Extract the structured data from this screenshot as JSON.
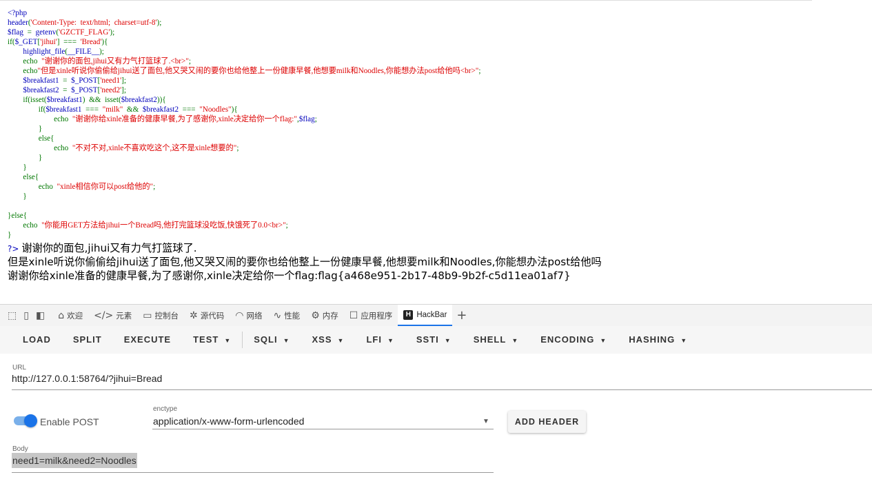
{
  "code_lines": [
    [
      [
        "v",
        "&lt;?php"
      ]
    ],
    [
      [
        "v",
        "header"
      ],
      [
        "k",
        "("
      ],
      [
        "s",
        "'Content-Type:  text/html;  charset=utf-8'"
      ],
      [
        "k",
        ");"
      ]
    ],
    [
      [
        "v",
        "$flag"
      ],
      [
        "k",
        "  =  "
      ],
      [
        "v",
        "getenv"
      ],
      [
        "k",
        "("
      ],
      [
        "s",
        "'GZCTF_FLAG'"
      ],
      [
        "k",
        ");"
      ]
    ],
    [
      [
        "k",
        "if("
      ],
      [
        "v",
        "$_GET"
      ],
      [
        "k",
        "["
      ],
      [
        "s",
        "'jihui'"
      ],
      [
        "k",
        "]  ===  "
      ],
      [
        "s",
        "'Bread'"
      ],
      [
        "k",
        "){"
      ]
    ],
    [
      [
        "k",
        "        "
      ],
      [
        "v",
        "highlight_file"
      ],
      [
        "k",
        "("
      ],
      [
        "v",
        "__FILE__"
      ],
      [
        "k",
        ");"
      ]
    ],
    [
      [
        "k",
        "        echo  "
      ],
      [
        "s",
        "\"谢谢你的面包,jihui又有力气打篮球了.&lt;br&gt;\""
      ],
      [
        "k",
        ";"
      ]
    ],
    [
      [
        "k",
        "        echo"
      ],
      [
        "s",
        "\"但是xinle听说你偷偷给jihui送了面包,他又哭又闹的要你也给他整上一份健康早餐,他想要milk和Noodles,你能想办法post给他吗&lt;br&gt;\""
      ],
      [
        "k",
        ";"
      ]
    ],
    [
      [
        "k",
        "        "
      ],
      [
        "v",
        "$breakfast1"
      ],
      [
        "k",
        "  =  "
      ],
      [
        "v",
        "$_POST"
      ],
      [
        "k",
        "["
      ],
      [
        "s",
        "'need1'"
      ],
      [
        "k",
        "];"
      ]
    ],
    [
      [
        "k",
        "        "
      ],
      [
        "v",
        "$breakfast2"
      ],
      [
        "k",
        "  =  "
      ],
      [
        "v",
        "$_POST"
      ],
      [
        "k",
        "["
      ],
      [
        "s",
        "'need2'"
      ],
      [
        "k",
        "];"
      ]
    ],
    [
      [
        "k",
        "        if(isset("
      ],
      [
        "v",
        "$breakfast1"
      ],
      [
        "k",
        ")  &amp;&amp;  isset("
      ],
      [
        "v",
        "$breakfast2"
      ],
      [
        "k",
        ")){"
      ]
    ],
    [
      [
        "k",
        "                if("
      ],
      [
        "v",
        "$breakfast1"
      ],
      [
        "k",
        "  ===  "
      ],
      [
        "s",
        "\"milk\""
      ],
      [
        "k",
        "  &amp;&amp;  "
      ],
      [
        "v",
        "$breakfast2"
      ],
      [
        "k",
        "  ===  "
      ],
      [
        "s",
        "\"Noodles\""
      ],
      [
        "k",
        "){"
      ]
    ],
    [
      [
        "k",
        "                        echo  "
      ],
      [
        "s",
        "\"谢谢你给xinle准备的健康早餐,为了感谢你,xinle决定给你一个flag:\""
      ],
      [
        "k",
        ","
      ],
      [
        "v",
        "$flag"
      ],
      [
        "k",
        ";"
      ]
    ],
    [
      [
        "k",
        "                }"
      ]
    ],
    [
      [
        "k",
        "                else{"
      ]
    ],
    [
      [
        "k",
        "                        echo  "
      ],
      [
        "s",
        "\"不对不对,xinle不喜欢吃这个,这不是xinle想要的\""
      ],
      [
        "k",
        ";"
      ]
    ],
    [
      [
        "k",
        "                }"
      ]
    ],
    [
      [
        "k",
        "        }"
      ]
    ],
    [
      [
        "k",
        "        else{"
      ]
    ],
    [
      [
        "k",
        "                echo  "
      ],
      [
        "s",
        "\"xinle相信你可以post给他的\""
      ],
      [
        "k",
        ";"
      ]
    ],
    [
      [
        "k",
        "        }"
      ]
    ],
    [
      [
        "k",
        " "
      ]
    ],
    [
      [
        "k",
        "}else{"
      ]
    ],
    [
      [
        "k",
        "        echo  "
      ],
      [
        "s",
        "\"你能用GET方法给jihui一个Bread吗,他打完篮球没吃饭,快饿死了0.0&lt;br&gt;\""
      ],
      [
        "k",
        ";"
      ]
    ],
    [
      [
        "k",
        "}"
      ]
    ]
  ],
  "output": {
    "prompt": "?>",
    "line1": "谢谢你的面包,jihui又有力气打篮球了.",
    "line2": "但是xinle听说你偷偷给jihui送了面包,他又哭又闹的要你也给他整上一份健康早餐,他想要milk和Noodles,你能想办法post给他吗",
    "line3": "谢谢你给xinle准备的健康早餐,为了感谢你,xinle决定给你一个flag:flag{a468e951-2b17-48b9-9b2f-c5d11ea01af7}"
  },
  "devtools": {
    "tabs": [
      {
        "icon": "⌂",
        "label": "欢迎"
      },
      {
        "icon": "</>",
        "label": "元素"
      },
      {
        "icon": "▭",
        "label": "控制台"
      },
      {
        "icon": "✲",
        "label": "源代码"
      },
      {
        "icon": "◠",
        "label": "网络"
      },
      {
        "icon": "∿",
        "label": "性能"
      },
      {
        "icon": "⚙",
        "label": "内存"
      },
      {
        "icon": "☐",
        "label": "应用程序"
      }
    ],
    "active_tab": {
      "badge": "H",
      "label": "HackBar"
    }
  },
  "hackbar": {
    "load": "LOAD",
    "split": "SPLIT",
    "execute": "EXECUTE",
    "test": "TEST",
    "sqli": "SQLI",
    "xss": "XSS",
    "lfi": "LFI",
    "ssti": "SSTI",
    "shell": "SHELL",
    "encoding": "ENCODING",
    "hashing": "HASHING"
  },
  "form": {
    "url_label": "URL",
    "url_value": "http://127.0.0.1:58764/?jihui=Bread",
    "enable_post_label": "Enable POST",
    "enable_post": true,
    "enctype_label": "enctype",
    "enctype_value": "application/x-www-form-urlencoded",
    "add_header": "ADD HEADER",
    "body_label": "Body",
    "body_value": "need1=milk&need2=Noodles"
  }
}
